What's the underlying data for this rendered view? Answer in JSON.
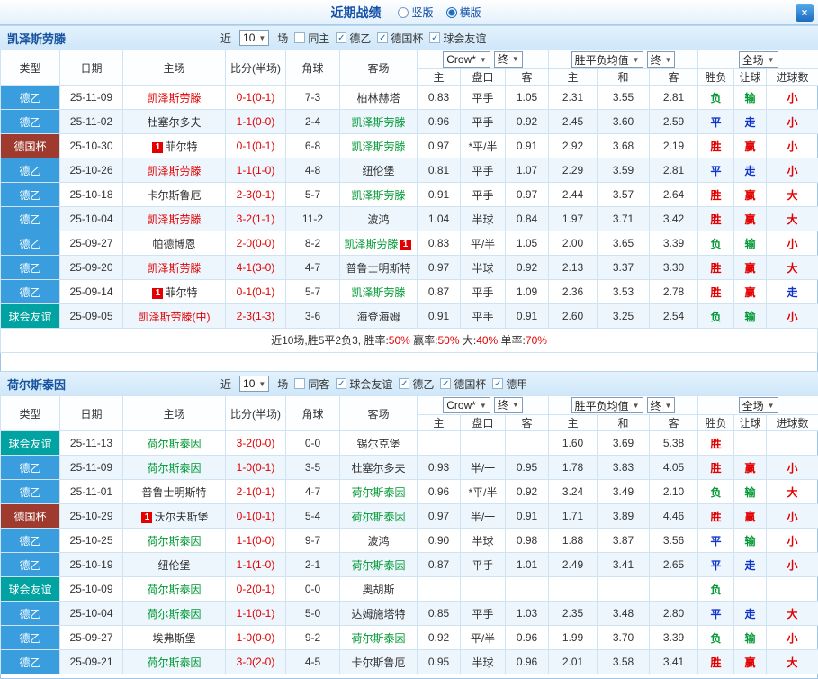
{
  "topbar": {
    "title": "近期战绩",
    "radio_vertical": "竖版",
    "radio_horizontal": "横版",
    "close_glyph": "×"
  },
  "filter_common": {
    "near": "近",
    "games": "场"
  },
  "header_labels": {
    "type": "类型",
    "date": "日期",
    "home": "主场",
    "score": "比分(半场)",
    "corners": "角球",
    "away": "客场",
    "odds_select": "Crow*",
    "final_select": "终",
    "mean_select": "胜平负均值",
    "fulltime_select": "全场",
    "odds_home": "主",
    "odds_line": "盘口",
    "odds_away": "客",
    "mean_home": "主",
    "mean_draw": "和",
    "mean_away": "客",
    "result_wdl": "胜负",
    "result_handicap": "让球",
    "result_goals": "进球数"
  },
  "palette": {
    "red": "#e30000",
    "green": "#009933",
    "blue": "#1133cc",
    "black": "#333333"
  },
  "type_colors": {
    "德乙": "#3a9ede",
    "德国杯": "#9e3a2e",
    "球会友谊": "#00a2a2"
  },
  "sections": [
    {
      "team": "凯泽斯劳滕",
      "recent_count": "10",
      "filters": [
        {
          "label": "同主",
          "checked": false
        },
        {
          "label": "德乙",
          "checked": true
        },
        {
          "label": "德国杯",
          "checked": true
        },
        {
          "label": "球会友谊",
          "checked": true
        }
      ],
      "rows": [
        {
          "type": "德乙",
          "date": "25-11-09",
          "home": {
            "name": "凯泽斯劳滕",
            "color": "red"
          },
          "score": "0-1(0-1)",
          "corners": "7-3",
          "away": {
            "name": "柏林赫塔",
            "color": "black"
          },
          "odds": [
            "0.83",
            "平手",
            "1.05"
          ],
          "means": [
            "2.31",
            "3.55",
            "2.81"
          ],
          "results": [
            {
              "t": "负",
              "c": "green"
            },
            {
              "t": "输",
              "c": "green"
            },
            {
              "t": "小",
              "c": "red"
            }
          ]
        },
        {
          "type": "德乙",
          "date": "25-11-02",
          "home": {
            "name": "杜塞尔多夫",
            "color": "black"
          },
          "score": "1-1(0-0)",
          "corners": "2-4",
          "away": {
            "name": "凯泽斯劳滕",
            "color": "green"
          },
          "odds": [
            "0.96",
            "平手",
            "0.92"
          ],
          "means": [
            "2.45",
            "3.60",
            "2.59"
          ],
          "results": [
            {
              "t": "平",
              "c": "blue"
            },
            {
              "t": "走",
              "c": "blue"
            },
            {
              "t": "小",
              "c": "red"
            }
          ]
        },
        {
          "type": "德国杯",
          "date": "25-10-30",
          "home": {
            "name": "菲尔特",
            "color": "black",
            "badge": "1",
            "badge_pos": "before"
          },
          "score": "0-1(0-1)",
          "corners": "6-8",
          "away": {
            "name": "凯泽斯劳滕",
            "color": "green"
          },
          "odds": [
            "0.97",
            "*平/半",
            "0.91"
          ],
          "means": [
            "2.92",
            "3.68",
            "2.19"
          ],
          "results": [
            {
              "t": "胜",
              "c": "red"
            },
            {
              "t": "赢",
              "c": "red"
            },
            {
              "t": "小",
              "c": "red"
            }
          ]
        },
        {
          "type": "德乙",
          "date": "25-10-26",
          "home": {
            "name": "凯泽斯劳滕",
            "color": "red"
          },
          "score": "1-1(1-0)",
          "corners": "4-8",
          "away": {
            "name": "纽伦堡",
            "color": "black"
          },
          "odds": [
            "0.81",
            "平手",
            "1.07"
          ],
          "means": [
            "2.29",
            "3.59",
            "2.81"
          ],
          "results": [
            {
              "t": "平",
              "c": "blue"
            },
            {
              "t": "走",
              "c": "blue"
            },
            {
              "t": "小",
              "c": "red"
            }
          ]
        },
        {
          "type": "德乙",
          "date": "25-10-18",
          "home": {
            "name": "卡尔斯鲁厄",
            "color": "black"
          },
          "score": "2-3(0-1)",
          "corners": "5-7",
          "away": {
            "name": "凯泽斯劳滕",
            "color": "green"
          },
          "odds": [
            "0.91",
            "平手",
            "0.97"
          ],
          "means": [
            "2.44",
            "3.57",
            "2.64"
          ],
          "results": [
            {
              "t": "胜",
              "c": "red"
            },
            {
              "t": "赢",
              "c": "red"
            },
            {
              "t": "大",
              "c": "red"
            }
          ]
        },
        {
          "type": "德乙",
          "date": "25-10-04",
          "home": {
            "name": "凯泽斯劳滕",
            "color": "red"
          },
          "score": "3-2(1-1)",
          "corners": "11-2",
          "away": {
            "name": "波鸿",
            "color": "black"
          },
          "odds": [
            "1.04",
            "半球",
            "0.84"
          ],
          "means": [
            "1.97",
            "3.71",
            "3.42"
          ],
          "results": [
            {
              "t": "胜",
              "c": "red"
            },
            {
              "t": "赢",
              "c": "red"
            },
            {
              "t": "大",
              "c": "red"
            }
          ]
        },
        {
          "type": "德乙",
          "date": "25-09-27",
          "home": {
            "name": "帕德博恩",
            "color": "black"
          },
          "score": "2-0(0-0)",
          "corners": "8-2",
          "away": {
            "name": "凯泽斯劳滕",
            "color": "green",
            "badge": "1",
            "badge_pos": "after"
          },
          "odds": [
            "0.83",
            "平/半",
            "1.05"
          ],
          "means": [
            "2.00",
            "3.65",
            "3.39"
          ],
          "results": [
            {
              "t": "负",
              "c": "green"
            },
            {
              "t": "输",
              "c": "green"
            },
            {
              "t": "小",
              "c": "red"
            }
          ]
        },
        {
          "type": "德乙",
          "date": "25-09-20",
          "home": {
            "name": "凯泽斯劳滕",
            "color": "red"
          },
          "score": "4-1(3-0)",
          "corners": "4-7",
          "away": {
            "name": "普鲁士明斯特",
            "color": "black"
          },
          "odds": [
            "0.97",
            "半球",
            "0.92"
          ],
          "means": [
            "2.13",
            "3.37",
            "3.30"
          ],
          "results": [
            {
              "t": "胜",
              "c": "red"
            },
            {
              "t": "赢",
              "c": "red"
            },
            {
              "t": "大",
              "c": "red"
            }
          ]
        },
        {
          "type": "德乙",
          "date": "25-09-14",
          "home": {
            "name": "菲尔特",
            "color": "black",
            "badge": "1",
            "badge_pos": "before"
          },
          "score": "0-1(0-1)",
          "corners": "5-7",
          "away": {
            "name": "凯泽斯劳滕",
            "color": "green"
          },
          "odds": [
            "0.87",
            "平手",
            "1.09"
          ],
          "means": [
            "2.36",
            "3.53",
            "2.78"
          ],
          "results": [
            {
              "t": "胜",
              "c": "red"
            },
            {
              "t": "赢",
              "c": "red"
            },
            {
              "t": "走",
              "c": "blue"
            }
          ]
        },
        {
          "type": "球会友谊",
          "date": "25-09-05",
          "home": {
            "name": "凯泽斯劳滕(中)",
            "color": "red"
          },
          "score": "2-3(1-3)",
          "corners": "3-6",
          "away": {
            "name": "海登海姆",
            "color": "black"
          },
          "odds": [
            "0.91",
            "平手",
            "0.91"
          ],
          "means": [
            "2.60",
            "3.25",
            "2.54"
          ],
          "results": [
            {
              "t": "负",
              "c": "green"
            },
            {
              "t": "输",
              "c": "green"
            },
            {
              "t": "小",
              "c": "red"
            }
          ]
        }
      ],
      "summary": [
        {
          "text": "近10场,胜5平2负3, ",
          "color": "#333333"
        },
        {
          "text": "胜率:",
          "color": "#333333"
        },
        {
          "text": "50%",
          "color": "#e30000"
        },
        {
          "text": " 赢率:",
          "color": "#333333"
        },
        {
          "text": "50%",
          "color": "#e30000"
        },
        {
          "text": " 大:",
          "color": "#333333"
        },
        {
          "text": "40%",
          "color": "#e30000"
        },
        {
          "text": " 单率:",
          "color": "#333333"
        },
        {
          "text": "70%",
          "color": "#e30000"
        }
      ]
    },
    {
      "team": "荷尔斯泰因",
      "recent_count": "10",
      "filters": [
        {
          "label": "同客",
          "checked": false
        },
        {
          "label": "球会友谊",
          "checked": true
        },
        {
          "label": "德乙",
          "checked": true
        },
        {
          "label": "德国杯",
          "checked": true
        },
        {
          "label": "德甲",
          "checked": true
        }
      ],
      "rows": [
        {
          "type": "球会友谊",
          "date": "25-11-13",
          "home": {
            "name": "荷尔斯泰因",
            "color": "green"
          },
          "score": "3-2(0-0)",
          "corners": "0-0",
          "away": {
            "name": "锡尔克堡",
            "color": "black"
          },
          "odds": [
            "",
            "",
            ""
          ],
          "means": [
            "1.60",
            "3.69",
            "5.38"
          ],
          "results": [
            {
              "t": "胜",
              "c": "red"
            },
            {
              "t": "",
              "c": "black"
            },
            {
              "t": "",
              "c": "black"
            }
          ]
        },
        {
          "type": "德乙",
          "date": "25-11-09",
          "home": {
            "name": "荷尔斯泰因",
            "color": "green"
          },
          "score": "1-0(0-1)",
          "corners": "3-5",
          "away": {
            "name": "杜塞尔多夫",
            "color": "black"
          },
          "odds": [
            "0.93",
            "半/一",
            "0.95"
          ],
          "means": [
            "1.78",
            "3.83",
            "4.05"
          ],
          "results": [
            {
              "t": "胜",
              "c": "red"
            },
            {
              "t": "赢",
              "c": "red"
            },
            {
              "t": "小",
              "c": "red"
            }
          ]
        },
        {
          "type": "德乙",
          "date": "25-11-01",
          "home": {
            "name": "普鲁士明斯特",
            "color": "black"
          },
          "score": "2-1(0-1)",
          "corners": "4-7",
          "away": {
            "name": "荷尔斯泰因",
            "color": "green"
          },
          "odds": [
            "0.96",
            "*平/半",
            "0.92"
          ],
          "means": [
            "3.24",
            "3.49",
            "2.10"
          ],
          "results": [
            {
              "t": "负",
              "c": "green"
            },
            {
              "t": "输",
              "c": "green"
            },
            {
              "t": "大",
              "c": "red"
            }
          ]
        },
        {
          "type": "德国杯",
          "date": "25-10-29",
          "home": {
            "name": "沃尔夫斯堡",
            "color": "black",
            "badge": "1",
            "badge_pos": "before"
          },
          "score": "0-1(0-1)",
          "corners": "5-4",
          "away": {
            "name": "荷尔斯泰因",
            "color": "green"
          },
          "odds": [
            "0.97",
            "半/一",
            "0.91"
          ],
          "means": [
            "1.71",
            "3.89",
            "4.46"
          ],
          "results": [
            {
              "t": "胜",
              "c": "red"
            },
            {
              "t": "赢",
              "c": "red"
            },
            {
              "t": "小",
              "c": "red"
            }
          ]
        },
        {
          "type": "德乙",
          "date": "25-10-25",
          "home": {
            "name": "荷尔斯泰因",
            "color": "green"
          },
          "score": "1-1(0-0)",
          "corners": "9-7",
          "away": {
            "name": "波鸿",
            "color": "black"
          },
          "odds": [
            "0.90",
            "半球",
            "0.98"
          ],
          "means": [
            "1.88",
            "3.87",
            "3.56"
          ],
          "results": [
            {
              "t": "平",
              "c": "blue"
            },
            {
              "t": "输",
              "c": "green"
            },
            {
              "t": "小",
              "c": "red"
            }
          ]
        },
        {
          "type": "德乙",
          "date": "25-10-19",
          "home": {
            "name": "纽伦堡",
            "color": "black"
          },
          "score": "1-1(1-0)",
          "corners": "2-1",
          "away": {
            "name": "荷尔斯泰因",
            "color": "green"
          },
          "odds": [
            "0.87",
            "平手",
            "1.01"
          ],
          "means": [
            "2.49",
            "3.41",
            "2.65"
          ],
          "results": [
            {
              "t": "平",
              "c": "blue"
            },
            {
              "t": "走",
              "c": "blue"
            },
            {
              "t": "小",
              "c": "red"
            }
          ]
        },
        {
          "type": "球会友谊",
          "date": "25-10-09",
          "home": {
            "name": "荷尔斯泰因",
            "color": "green"
          },
          "score": "0-2(0-1)",
          "corners": "0-0",
          "away": {
            "name": "奥胡斯",
            "color": "black"
          },
          "odds": [
            "",
            "",
            ""
          ],
          "means": [
            "",
            "",
            ""
          ],
          "results": [
            {
              "t": "负",
              "c": "green"
            },
            {
              "t": "",
              "c": "black"
            },
            {
              "t": "",
              "c": "black"
            }
          ]
        },
        {
          "type": "德乙",
          "date": "25-10-04",
          "home": {
            "name": "荷尔斯泰因",
            "color": "green"
          },
          "score": "1-1(0-1)",
          "corners": "5-0",
          "away": {
            "name": "达姆施塔特",
            "color": "black"
          },
          "odds": [
            "0.85",
            "平手",
            "1.03"
          ],
          "means": [
            "2.35",
            "3.48",
            "2.80"
          ],
          "results": [
            {
              "t": "平",
              "c": "blue"
            },
            {
              "t": "走",
              "c": "blue"
            },
            {
              "t": "大",
              "c": "red"
            }
          ]
        },
        {
          "type": "德乙",
          "date": "25-09-27",
          "home": {
            "name": "埃弗斯堡",
            "color": "black"
          },
          "score": "1-0(0-0)",
          "corners": "9-2",
          "away": {
            "name": "荷尔斯泰因",
            "color": "green"
          },
          "odds": [
            "0.92",
            "平/半",
            "0.96"
          ],
          "means": [
            "1.99",
            "3.70",
            "3.39"
          ],
          "results": [
            {
              "t": "负",
              "c": "green"
            },
            {
              "t": "输",
              "c": "green"
            },
            {
              "t": "小",
              "c": "red"
            }
          ]
        },
        {
          "type": "德乙",
          "date": "25-09-21",
          "home": {
            "name": "荷尔斯泰因",
            "color": "green"
          },
          "score": "3-0(2-0)",
          "corners": "4-5",
          "away": {
            "name": "卡尔斯鲁厄",
            "color": "black"
          },
          "odds": [
            "0.95",
            "半球",
            "0.96"
          ],
          "means": [
            "2.01",
            "3.58",
            "3.41"
          ],
          "results": [
            {
              "t": "胜",
              "c": "red"
            },
            {
              "t": "赢",
              "c": "red"
            },
            {
              "t": "大",
              "c": "red"
            }
          ]
        }
      ],
      "summary": null
    }
  ]
}
